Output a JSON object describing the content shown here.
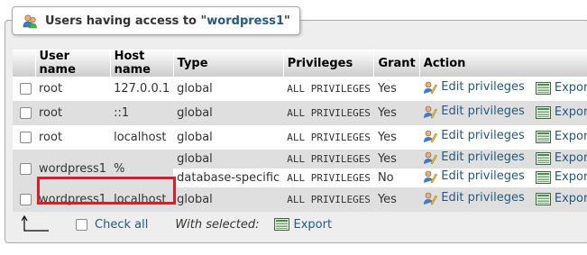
{
  "legend": {
    "prefix": "Users having access to \"",
    "db": "wordpress1",
    "suffix": "\""
  },
  "columns": [
    "User name",
    "Host name",
    "Type",
    "Privileges",
    "Grant",
    "Action"
  ],
  "rows": [
    {
      "user": "root",
      "host": "127.0.0.1",
      "type": "global",
      "privileges": "ALL PRIVILEGES",
      "grant": "Yes"
    },
    {
      "user": "root",
      "host": "::1",
      "type": "global",
      "privileges": "ALL PRIVILEGES",
      "grant": "Yes"
    },
    {
      "user": "root",
      "host": "localhost",
      "type": "global",
      "privileges": "ALL PRIVILEGES",
      "grant": "Yes"
    },
    {
      "user": "wordpress1",
      "host": "%",
      "type": "global",
      "privileges": "ALL PRIVILEGES",
      "grant": "Yes",
      "sub": {
        "type": "database-specific",
        "privileges": "ALL PRIVILEGES",
        "grant": "No"
      }
    },
    {
      "user": "wordpress1",
      "host": "localhost",
      "type": "global",
      "privileges": "ALL PRIVILEGES",
      "grant": "Yes"
    }
  ],
  "actions": {
    "edit": "Edit privileges",
    "export": "Export"
  },
  "footer": {
    "check_all": "Check all",
    "with_selected": "With selected:",
    "export": "Export"
  },
  "colors": {
    "link": "#235a81",
    "highlight": "#e01b24",
    "header_bg": "#cccccc",
    "row_even": "#dfdfdf"
  },
  "icons": [
    "users-icon",
    "edit-privileges-icon",
    "export-icon",
    "arrow-left-icon"
  ]
}
